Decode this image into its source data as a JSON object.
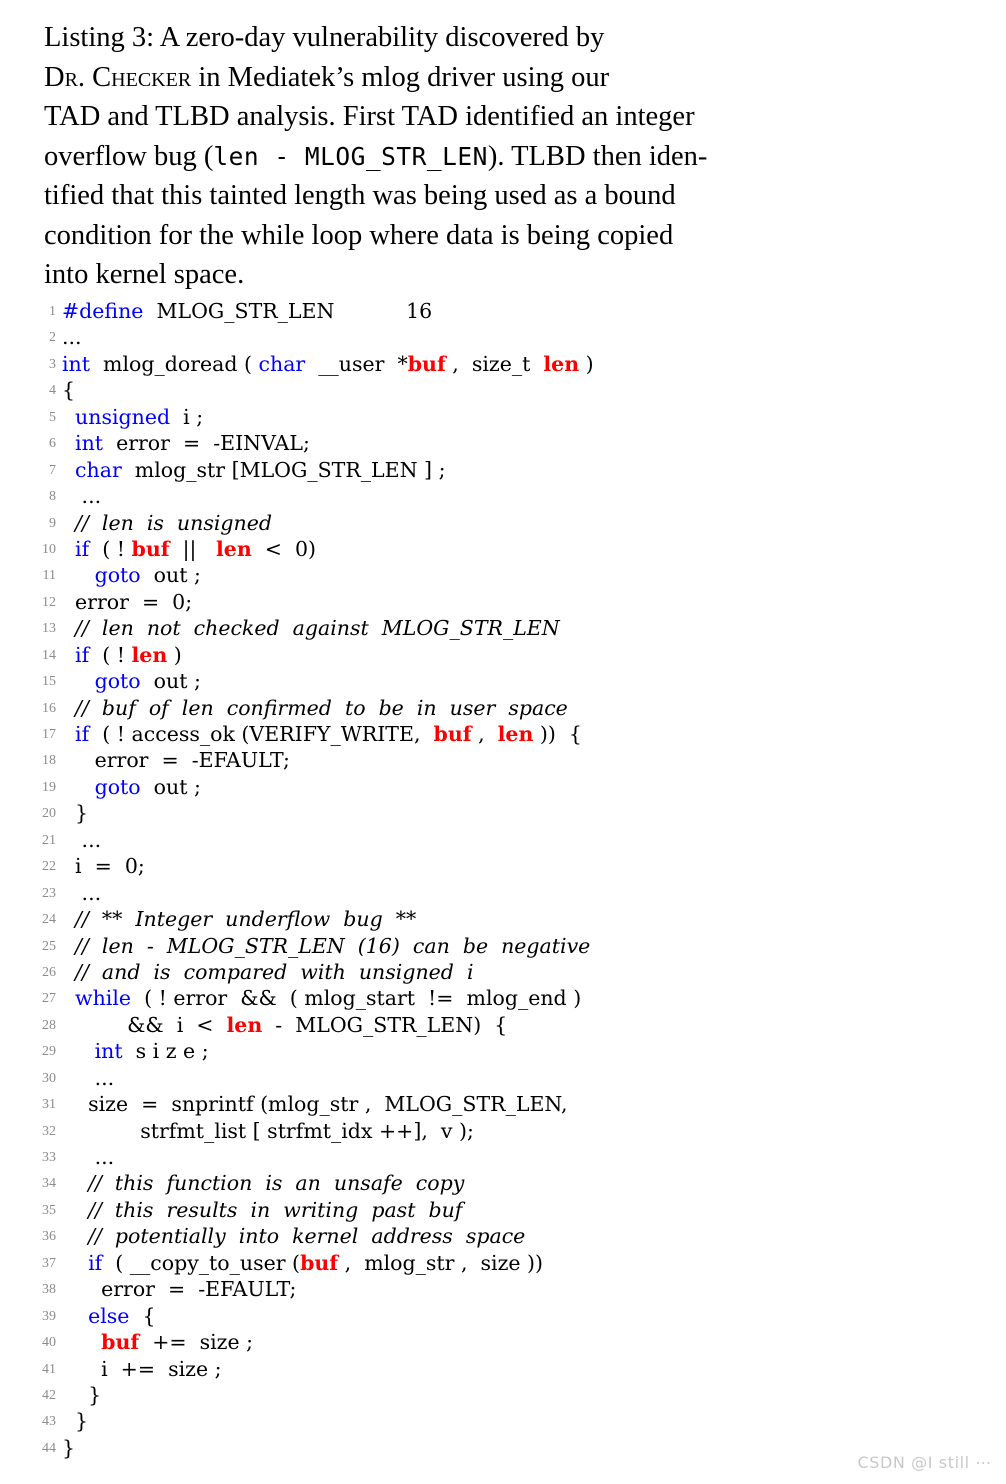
{
  "caption": {
    "label": "Listing 3:",
    "lines": [
      [
        {
          "t": "text",
          "v": "Listing 3:   A zero-day vulnerability discovered by"
        }
      ],
      [
        {
          "t": "smallcaps",
          "v": "Dr. Checker"
        },
        {
          "t": "text",
          "v": " in Mediatek’s mlog driver  using our"
        }
      ],
      [
        {
          "t": "text",
          "v": "TAD and TLBD analysis. First  TAD identified an integer"
        }
      ],
      [
        {
          "t": "text",
          "v": "overflow bug ("
        },
        {
          "t": "tt",
          "v": "len - MLOG_STR_LEN"
        },
        {
          "t": "text",
          "v": "). TLBD then iden-"
        }
      ],
      [
        {
          "t": "text",
          "v": "tified that this tainted length was being used as a bound"
        }
      ],
      [
        {
          "t": "text",
          "v": "condition for the while loop  where data is being copied"
        }
      ],
      [
        {
          "t": "text",
          "v": "into kernel space."
        }
      ]
    ],
    "full_text": "Listing 3: A zero-day vulnerability discovered by Dr. Checker in Mediatek's mlog driver using our TAD and TLBD analysis. First TAD identified an integer overflow bug (len - MLOG_STR_LEN). TLBD then identified that this tainted length was being used as a bound condition for the while loop where data is being copied into kernel space."
  },
  "colors": {
    "keyword": "#0000ff",
    "tainted": "#ff0000",
    "comment": "#000000",
    "plain": "#000000",
    "lineno": "#8c8c8c",
    "background": "#ffffff",
    "watermark": "#c9c9c9"
  },
  "listing": {
    "language": "C",
    "first_line_number": 1,
    "last_line_number": 44,
    "lines": [
      {
        "n": "1",
        "spans": [
          {
            "c": "kw",
            "v": "#define"
          },
          {
            "c": "pl",
            "v": "  MLOG_STR_LEN           16"
          }
        ]
      },
      {
        "n": "2",
        "spans": [
          {
            "c": "pl",
            "v": "..."
          }
        ]
      },
      {
        "n": "3",
        "spans": [
          {
            "c": "kw",
            "v": "int"
          },
          {
            "c": "pl",
            "v": "  mlog_doread ( "
          },
          {
            "c": "kw",
            "v": "char"
          },
          {
            "c": "pl",
            "v": "  __user  *"
          },
          {
            "c": "tnt",
            "v": "buf"
          },
          {
            "c": "pl",
            "v": " ,  size_t  "
          },
          {
            "c": "tnt",
            "v": "len"
          },
          {
            "c": "pl",
            "v": " )"
          }
        ]
      },
      {
        "n": "4",
        "spans": [
          {
            "c": "pl",
            "v": "{"
          }
        ]
      },
      {
        "n": "5",
        "spans": [
          {
            "c": "pl",
            "v": "  "
          },
          {
            "c": "kw",
            "v": "unsigned"
          },
          {
            "c": "pl",
            "v": "  i ;"
          }
        ]
      },
      {
        "n": "6",
        "spans": [
          {
            "c": "pl",
            "v": "  "
          },
          {
            "c": "kw",
            "v": "int"
          },
          {
            "c": "pl",
            "v": "  error  =  -EINVAL;"
          }
        ]
      },
      {
        "n": "7",
        "spans": [
          {
            "c": "pl",
            "v": "  "
          },
          {
            "c": "kw",
            "v": "char"
          },
          {
            "c": "pl",
            "v": "  mlog_str [MLOG_STR_LEN ] ;"
          }
        ]
      },
      {
        "n": "8",
        "spans": [
          {
            "c": "pl",
            "v": "   ..."
          }
        ]
      },
      {
        "n": "9",
        "spans": [
          {
            "c": "pl",
            "v": "  "
          },
          {
            "c": "cmt",
            "v": "//  len  is  unsigned"
          }
        ]
      },
      {
        "n": "10",
        "spans": [
          {
            "c": "pl",
            "v": "  "
          },
          {
            "c": "kw",
            "v": "if"
          },
          {
            "c": "pl",
            "v": "  ( ! "
          },
          {
            "c": "tnt",
            "v": "buf"
          },
          {
            "c": "pl",
            "v": "  ||   "
          },
          {
            "c": "tnt",
            "v": "len"
          },
          {
            "c": "pl",
            "v": "  <  0)"
          }
        ]
      },
      {
        "n": "11",
        "spans": [
          {
            "c": "pl",
            "v": "     "
          },
          {
            "c": "kw",
            "v": "goto"
          },
          {
            "c": "pl",
            "v": "  out ;"
          }
        ]
      },
      {
        "n": "12",
        "spans": [
          {
            "c": "pl",
            "v": "  error  =  0;"
          }
        ]
      },
      {
        "n": "13",
        "spans": [
          {
            "c": "pl",
            "v": "  "
          },
          {
            "c": "cmt",
            "v": "//  len  not  checked  against  MLOG_STR_LEN"
          }
        ]
      },
      {
        "n": "14",
        "spans": [
          {
            "c": "pl",
            "v": "  "
          },
          {
            "c": "kw",
            "v": "if"
          },
          {
            "c": "pl",
            "v": "  ( ! "
          },
          {
            "c": "tnt",
            "v": "len"
          },
          {
            "c": "pl",
            "v": " )"
          }
        ]
      },
      {
        "n": "15",
        "spans": [
          {
            "c": "pl",
            "v": "     "
          },
          {
            "c": "kw",
            "v": "goto"
          },
          {
            "c": "pl",
            "v": "  out ;"
          }
        ]
      },
      {
        "n": "16",
        "spans": [
          {
            "c": "pl",
            "v": "  "
          },
          {
            "c": "cmt",
            "v": "//  buf  of  len  confirmed  to  be  in  user  space"
          }
        ]
      },
      {
        "n": "17",
        "spans": [
          {
            "c": "pl",
            "v": "  "
          },
          {
            "c": "kw",
            "v": "if"
          },
          {
            "c": "pl",
            "v": "  ( ! access_ok (VERIFY_WRITE,  "
          },
          {
            "c": "tnt",
            "v": "buf"
          },
          {
            "c": "pl",
            "v": " ,  "
          },
          {
            "c": "tnt",
            "v": "len"
          },
          {
            "c": "pl",
            "v": " ))  {"
          }
        ]
      },
      {
        "n": "18",
        "spans": [
          {
            "c": "pl",
            "v": "     error  =  -EFAULT;"
          }
        ]
      },
      {
        "n": "19",
        "spans": [
          {
            "c": "pl",
            "v": "     "
          },
          {
            "c": "kw",
            "v": "goto"
          },
          {
            "c": "pl",
            "v": "  out ;"
          }
        ]
      },
      {
        "n": "20",
        "spans": [
          {
            "c": "pl",
            "v": "  }"
          }
        ]
      },
      {
        "n": "21",
        "spans": [
          {
            "c": "pl",
            "v": "   ..."
          }
        ]
      },
      {
        "n": "22",
        "spans": [
          {
            "c": "pl",
            "v": "  i  =  0;"
          }
        ]
      },
      {
        "n": "23",
        "spans": [
          {
            "c": "pl",
            "v": "   ..."
          }
        ]
      },
      {
        "n": "24",
        "spans": [
          {
            "c": "pl",
            "v": "  "
          },
          {
            "c": "cmt",
            "v": "//  **  Integer  underflow  bug  **"
          }
        ]
      },
      {
        "n": "25",
        "spans": [
          {
            "c": "pl",
            "v": "  "
          },
          {
            "c": "cmt",
            "v": "//  len  -  MLOG_STR_LEN  (16)  can  be  negative"
          }
        ]
      },
      {
        "n": "26",
        "spans": [
          {
            "c": "pl",
            "v": "  "
          },
          {
            "c": "cmt",
            "v": "//  and  is  compared  with  unsigned  i"
          }
        ]
      },
      {
        "n": "27",
        "spans": [
          {
            "c": "pl",
            "v": "  "
          },
          {
            "c": "kw",
            "v": "while"
          },
          {
            "c": "pl",
            "v": "  ( ! error  &&  ( mlog_start  !=  mlog_end )"
          }
        ]
      },
      {
        "n": "28",
        "spans": [
          {
            "c": "pl",
            "v": "          &&  i  <  "
          },
          {
            "c": "tnt",
            "v": "len"
          },
          {
            "c": "pl",
            "v": "  -  MLOG_STR_LEN)  {"
          }
        ]
      },
      {
        "n": "29",
        "spans": [
          {
            "c": "pl",
            "v": "     "
          },
          {
            "c": "kw",
            "v": "int"
          },
          {
            "c": "pl",
            "v": "  s i z e ;"
          }
        ]
      },
      {
        "n": "30",
        "spans": [
          {
            "c": "pl",
            "v": "     ..."
          }
        ]
      },
      {
        "n": "31",
        "spans": [
          {
            "c": "pl",
            "v": "    size  =  snprintf (mlog_str ,  MLOG_STR_LEN,"
          }
        ]
      },
      {
        "n": "32",
        "spans": [
          {
            "c": "pl",
            "v": "            strfmt_list [ strfmt_idx ++],  v );"
          }
        ]
      },
      {
        "n": "33",
        "spans": [
          {
            "c": "pl",
            "v": "     ..."
          }
        ]
      },
      {
        "n": "34",
        "spans": [
          {
            "c": "pl",
            "v": "    "
          },
          {
            "c": "cmt",
            "v": "//  this  function  is  an  unsafe  copy"
          }
        ]
      },
      {
        "n": "35",
        "spans": [
          {
            "c": "pl",
            "v": "    "
          },
          {
            "c": "cmt",
            "v": "//  this  results  in  writing  past  buf"
          }
        ]
      },
      {
        "n": "36",
        "spans": [
          {
            "c": "pl",
            "v": "    "
          },
          {
            "c": "cmt",
            "v": "//  potentially  into  kernel  address  space"
          }
        ]
      },
      {
        "n": "37",
        "spans": [
          {
            "c": "pl",
            "v": "    "
          },
          {
            "c": "kw",
            "v": "if"
          },
          {
            "c": "pl",
            "v": "  ( __copy_to_user ("
          },
          {
            "c": "tnt",
            "v": "buf"
          },
          {
            "c": "pl",
            "v": " ,  mlog_str ,  size ))"
          }
        ]
      },
      {
        "n": "38",
        "spans": [
          {
            "c": "pl",
            "v": "      error  =  -EFAULT;"
          }
        ]
      },
      {
        "n": "39",
        "spans": [
          {
            "c": "pl",
            "v": "    "
          },
          {
            "c": "kw",
            "v": "else"
          },
          {
            "c": "pl",
            "v": "  {"
          }
        ]
      },
      {
        "n": "40",
        "spans": [
          {
            "c": "pl",
            "v": "      "
          },
          {
            "c": "tnt",
            "v": "buf"
          },
          {
            "c": "pl",
            "v": "  +=  size ;"
          }
        ]
      },
      {
        "n": "41",
        "spans": [
          {
            "c": "pl",
            "v": "      i  +=  size ;"
          }
        ]
      },
      {
        "n": "42",
        "spans": [
          {
            "c": "pl",
            "v": "    }"
          }
        ]
      },
      {
        "n": "43",
        "spans": [
          {
            "c": "pl",
            "v": "  }"
          }
        ]
      },
      {
        "n": "44",
        "spans": [
          {
            "c": "pl",
            "v": "}"
          }
        ]
      }
    ]
  },
  "watermark": {
    "text": "CSDN @I still ⋯"
  }
}
